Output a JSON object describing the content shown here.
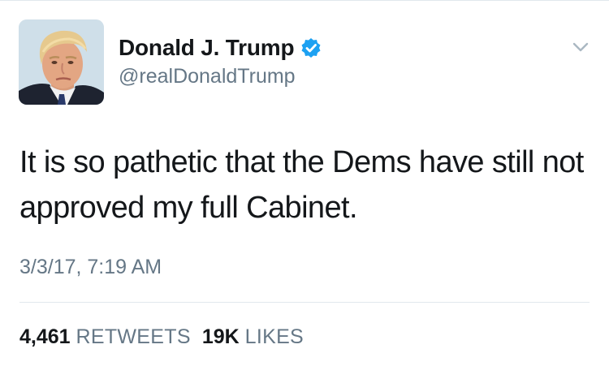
{
  "user": {
    "display_name": "Donald J. Trump",
    "handle": "@realDonaldTrump",
    "verified": true,
    "verified_icon": "verified-badge-icon",
    "avatar_icon": "profile-photo"
  },
  "menu": {
    "icon": "chevron-down-icon"
  },
  "tweet": {
    "text": "It is so pathetic that the Dems have still not approved my full Cabinet.",
    "timestamp": "3/3/17, 7:19 AM"
  },
  "stats": {
    "retweets_count": "4,461",
    "retweets_label": "RETWEETS",
    "likes_count": "19K",
    "likes_label": "LIKES"
  },
  "colors": {
    "text": "#14171a",
    "secondary": "#657786",
    "verified_blue": "#1da1f2",
    "divider": "#e1e8ed"
  }
}
